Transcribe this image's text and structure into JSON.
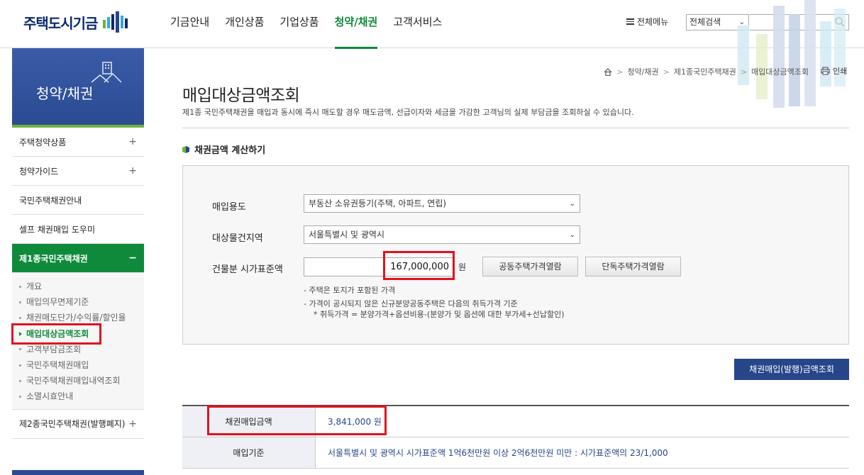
{
  "header": {
    "logo_text": "주택도시기금",
    "nav": [
      "기금안내",
      "개인상품",
      "기업상품",
      "청약/채권",
      "고객서비스"
    ],
    "active_nav_index": 3,
    "all_menu": "전체메뉴",
    "search_scope": "전체검색",
    "search_placeholder": ""
  },
  "sidebar": {
    "banner_title": "청약/채권",
    "items": [
      {
        "label": "주택청약상품",
        "toggle": "+"
      },
      {
        "label": "청약가이드",
        "toggle": "+"
      },
      {
        "label": "국민주택채권안내",
        "toggle": ""
      },
      {
        "label": "셀프 채권매입 도우미",
        "toggle": ""
      },
      {
        "label": "제1종국민주택채권",
        "toggle": "−"
      }
    ],
    "sub_items": [
      "개요",
      "매입의무면제기준",
      "채권매도단가/수익률/할인율",
      "매입대상금액조회",
      "고객부담금조회",
      "국민주택채권매입",
      "국민주택채권매입내역조회",
      "소멸시효안내"
    ],
    "active_sub_index": 3,
    "bottom_item": {
      "label": "제2종국민주택채권(발행폐지)",
      "toggle": "+"
    }
  },
  "breadcrumb": [
    "청약/채권",
    "제1종국민주택채권",
    "매입대상금액조회"
  ],
  "print_label": "인쇄",
  "page": {
    "title": "매입대상금액조회",
    "description": "제1종 국민주택채권을 매입과 동시에 즉시 매도할 경우 매도금액, 선급이자와 세금을 가감한 고객님의 실제 부담금을 조회하실 수 있습니다."
  },
  "section_title": "채권금액 계산하기",
  "form": {
    "purpose_label": "매입용도",
    "purpose_value": "부동산 소유권등기(주택, 아파트, 연립)",
    "region_label": "대상물건지역",
    "region_value": "서울특별시 및 광역시",
    "price_label": "건물분 시가표준액",
    "price_value": "167,000,000",
    "price_unit": "원",
    "btn_apt": "공동주택가격열람",
    "btn_house": "단독주택가격열람",
    "notes": [
      "- 주택은 토지가 포함된 가격",
      "- 가격이 공시되지 않은 신규분양공동주택은 다음의 취득가격 기준",
      "* 취득가격 = 분양가격+옵션비용-(분양가 및 옵션에 대한 부가세+선납할인)"
    ]
  },
  "calc_button": "채권매입(발행)금액조회",
  "result": {
    "amount_label": "채권매입금액",
    "amount_value": "3,841,000 원",
    "basis_label": "매입기준",
    "basis_value": "서울특별시 및 광역시 시가표준액 1억6천만원 이상 2억6천만원 미만 : 시가표준액의 23/1,000"
  },
  "colors": {
    "brand_blue": "#27468a",
    "accent_green": "#0f8a3b",
    "highlight_red": "#e0121e"
  }
}
